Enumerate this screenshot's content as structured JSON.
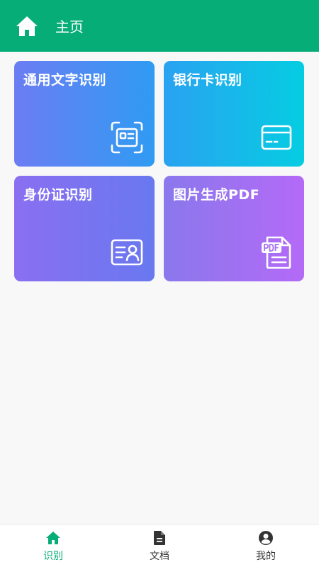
{
  "colors": {
    "primary": "#07ad76",
    "nav_inactive": "#333333",
    "card_text": "#ffffff"
  },
  "header": {
    "title": "主页",
    "home_icon": "home-icon"
  },
  "cards": [
    {
      "label": "通用文字识别",
      "icon": "scan-document-icon"
    },
    {
      "label": "银行卡识别",
      "icon": "credit-card-icon"
    },
    {
      "label": "身份证识别",
      "icon": "id-card-icon"
    },
    {
      "label": "图片生成PDF",
      "icon": "pdf-file-icon"
    }
  ],
  "bottom_nav": {
    "items": [
      {
        "label": "识别",
        "icon": "home-icon",
        "active": true
      },
      {
        "label": "文档",
        "icon": "document-icon",
        "active": false
      },
      {
        "label": "我的",
        "icon": "user-circle-icon",
        "active": false
      }
    ]
  }
}
